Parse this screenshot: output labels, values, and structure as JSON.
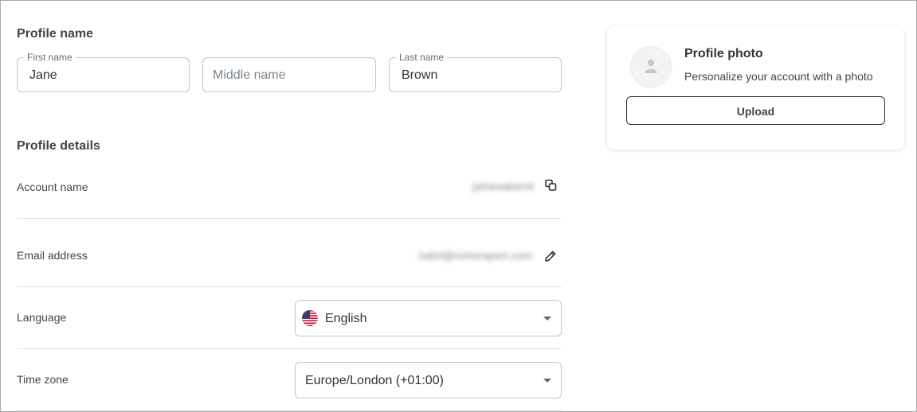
{
  "profile_name": {
    "title": "Profile name",
    "first_name": {
      "label": "First name",
      "value": "Jane"
    },
    "middle_name": {
      "placeholder": "Middle name"
    },
    "last_name": {
      "label": "Last name",
      "value": "Brown"
    }
  },
  "profile_details": {
    "title": "Profile details",
    "account_name": {
      "label": "Account name",
      "value": "jamesabernt"
    },
    "email_address": {
      "label": "Email address",
      "value": "sabri@romeraperi.com"
    },
    "language": {
      "label": "Language",
      "value": "English",
      "flag_icon": "us-flag-icon"
    },
    "time_zone": {
      "label": "Time zone",
      "value": "Europe/London (+01:00)"
    }
  },
  "photo_card": {
    "title": "Profile photo",
    "description": "Personalize your account with a photo",
    "upload_label": "Upload"
  },
  "colors": {
    "border": "#c4c4c4",
    "text": "#333333",
    "muted": "#7a8590",
    "divider": "#e3e3e3"
  }
}
